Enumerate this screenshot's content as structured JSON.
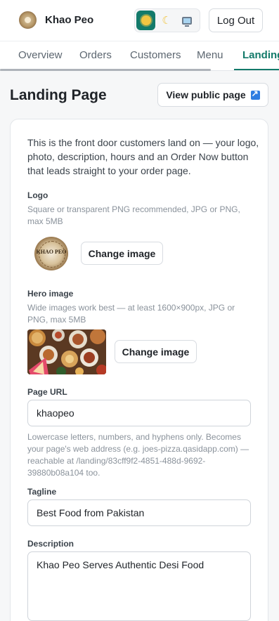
{
  "header": {
    "brand": "Khao Peo",
    "theme_options": [
      "light",
      "dark",
      "system"
    ],
    "theme_selected": "light",
    "logout_label": "Log Out"
  },
  "tabs": [
    {
      "label": "Overview"
    },
    {
      "label": "Orders"
    },
    {
      "label": "Customers"
    },
    {
      "label": "Menu"
    },
    {
      "label": "Landing"
    }
  ],
  "active_tab": "Landing",
  "page": {
    "title": "Landing Page",
    "view_public_label": "View public page"
  },
  "form": {
    "intro": "This is the front door customers land on — your logo, photo, description, hours and an Order Now button that leads straight to your order page.",
    "logo": {
      "label": "Logo",
      "help": "Square or transparent PNG recommended, JPG or PNG, max 5MB",
      "image_text": "KHAO PEO",
      "change_label": "Change image"
    },
    "hero": {
      "label": "Hero image",
      "help": "Wide images work best — at least 1600×900px, JPG or PNG, max 5MB",
      "change_label": "Change image"
    },
    "page_url": {
      "label": "Page URL",
      "value": "khaopeo",
      "help": "Lowercase letters, numbers, and hyphens only. Becomes your page's web address (e.g. joes-pizza.qasidapp.com) — reachable at /landing/83cff9f2-4851-488d-9692-39880b08a104 too."
    },
    "tagline": {
      "label": "Tagline",
      "value": "Best Food from Pakistan"
    },
    "description": {
      "label": "Description",
      "value": "Khao Peo Serves Authentic Desi Food"
    }
  },
  "colors": {
    "accent": "#137a6a",
    "text": "#1f2328",
    "muted": "#8a929b"
  }
}
